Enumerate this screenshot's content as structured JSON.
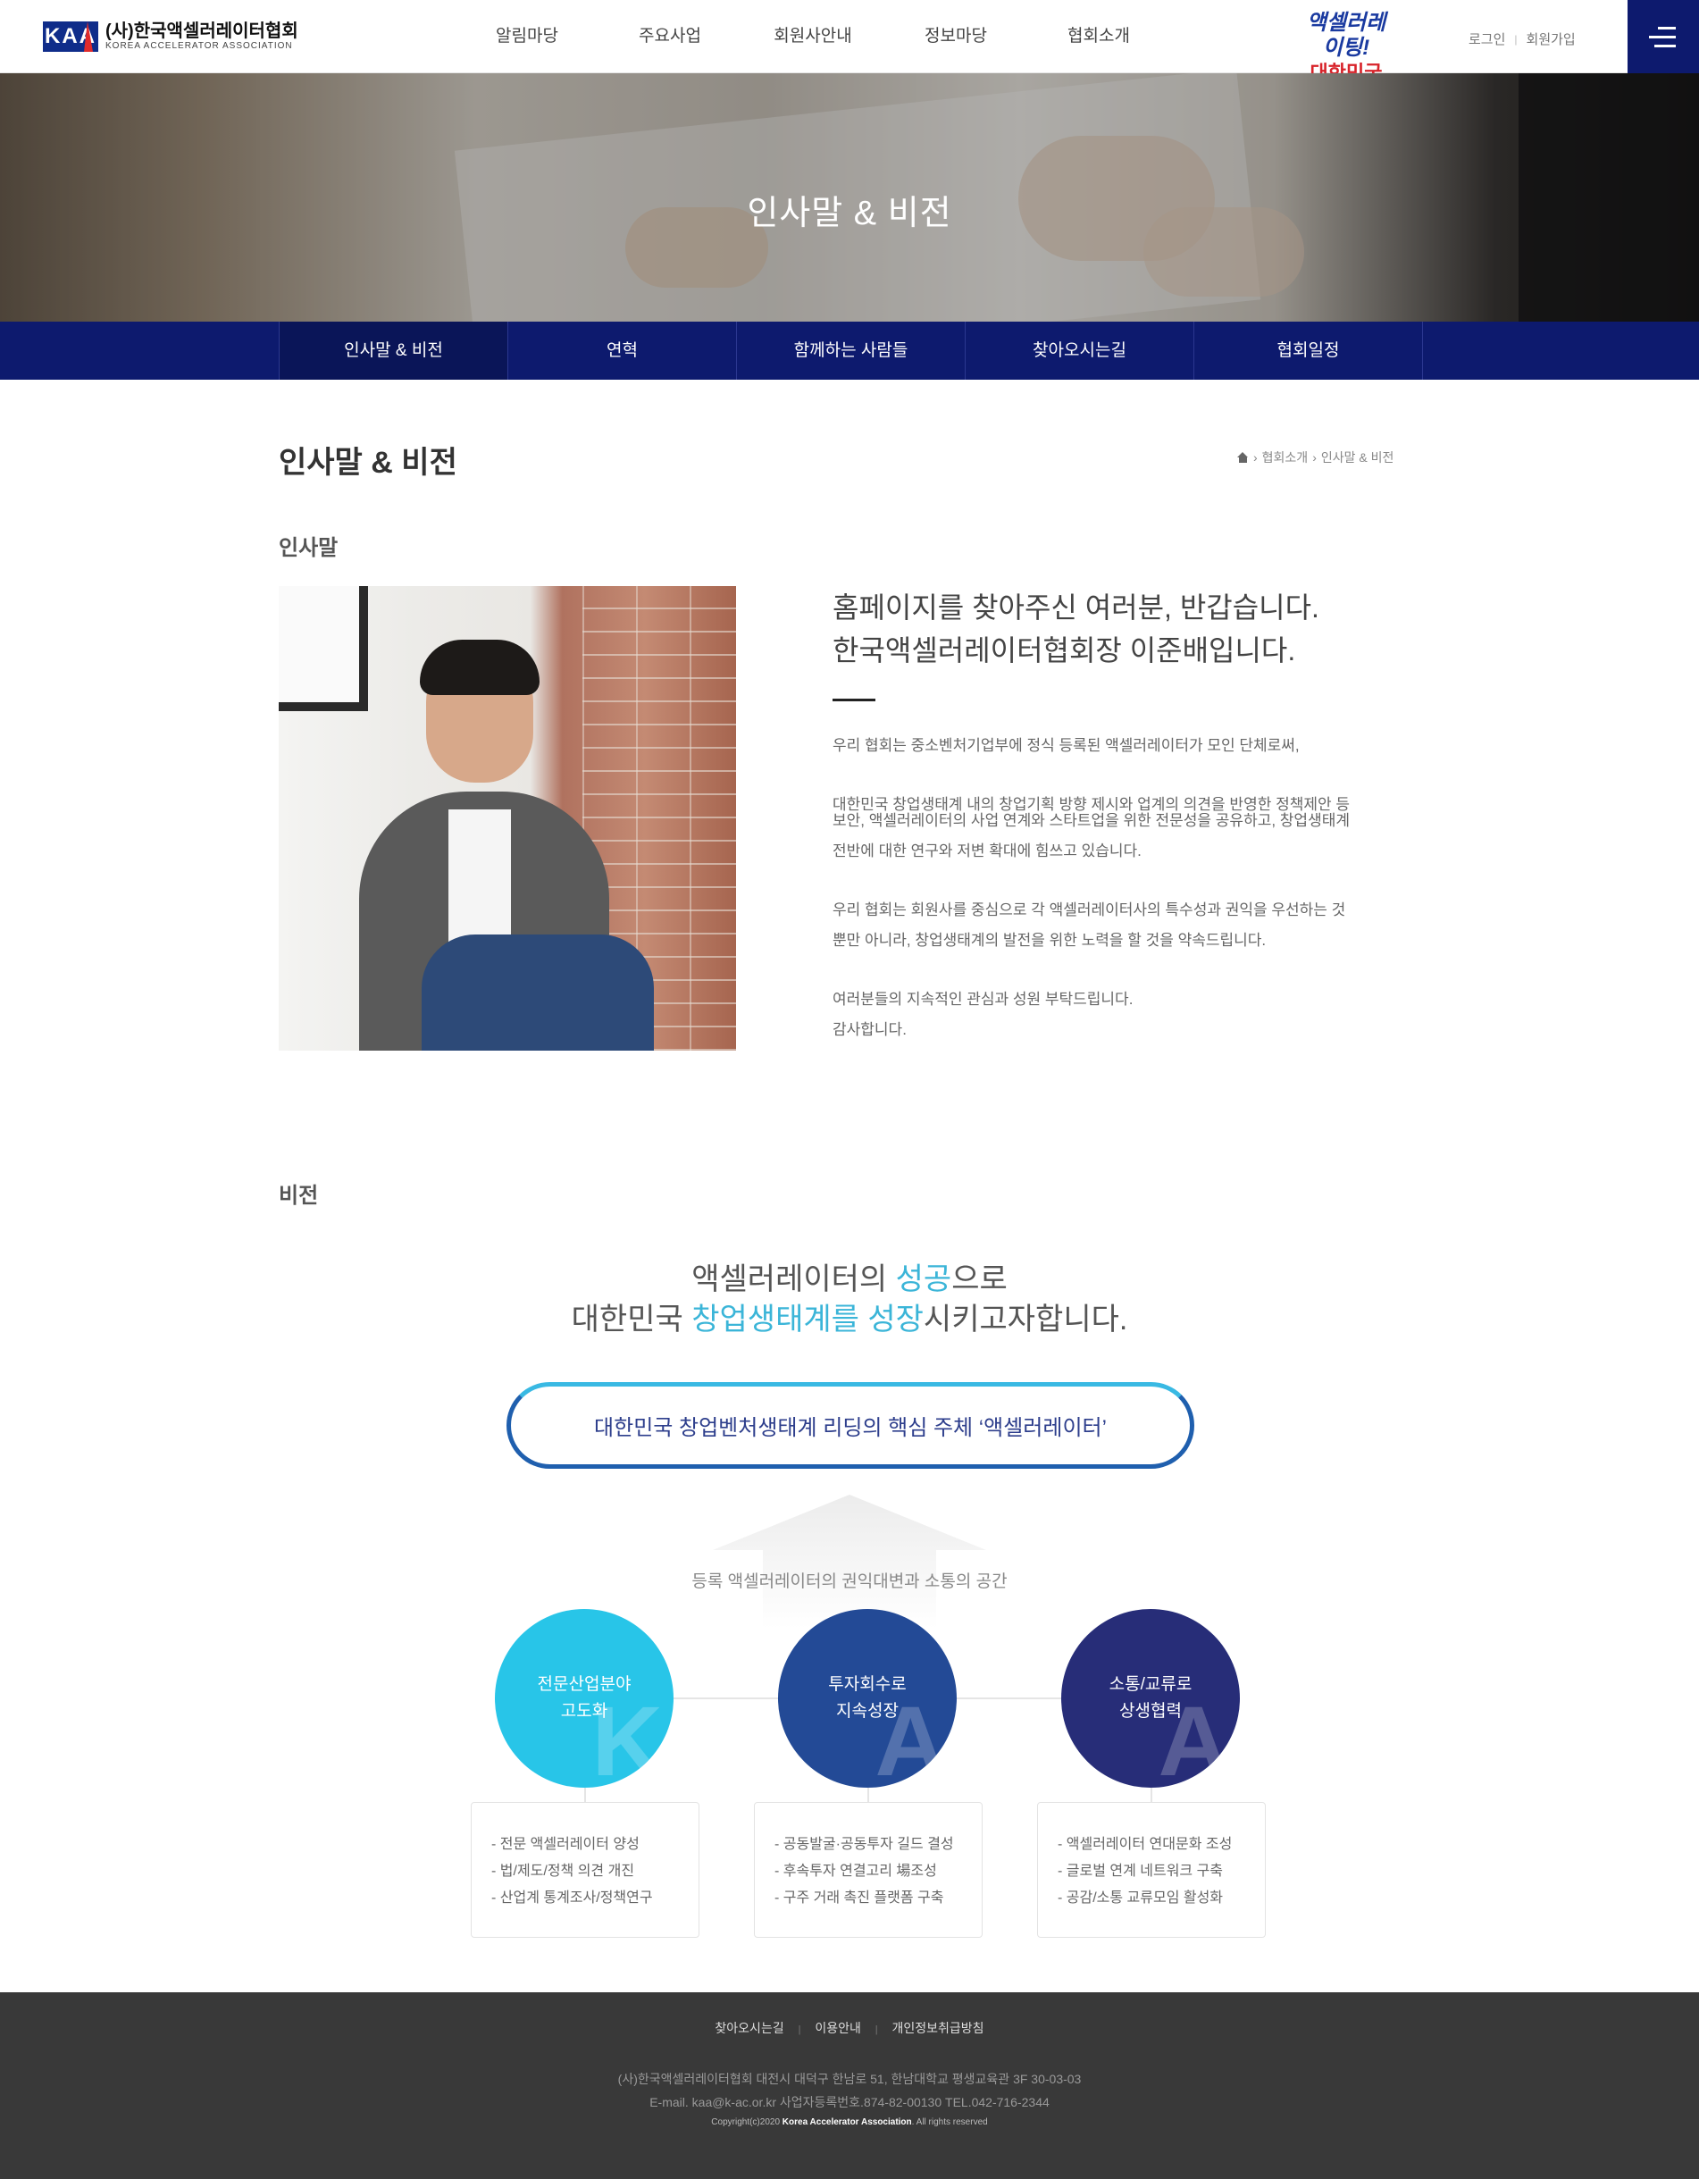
{
  "header": {
    "logo_mark": "KAA",
    "logo_kor": "(사)한국액셀러레이터협회",
    "logo_eng": "KOREA ACCELERATOR ASSOCIATION",
    "nav": [
      "알림마당",
      "주요사업",
      "회원사안내",
      "정보마당",
      "협회소개"
    ],
    "slogan_line1": "액셀러레이팅!",
    "slogan_line2": "대한민국",
    "login": "로그인",
    "join": "회원가입"
  },
  "hero": {
    "title": "인사말 & 비전"
  },
  "subnav": {
    "items": [
      "인사말 & 비전",
      "연혁",
      "함께하는 사람들",
      "찾아오시는길",
      "협회일정"
    ],
    "active_index": 0
  },
  "page": {
    "title": "인사말 & 비전",
    "breadcrumb": {
      "level1": "협회소개",
      "level2": "인사말 & 비전"
    }
  },
  "greeting": {
    "section_title": "인사말",
    "head_line1": "홈페이지를 찾아주신 여러분, 반갑습니다.",
    "head_line2": "한국액셀러레이터협회장 이준배입니다.",
    "p1": "우리 협회는 중소벤처기업부에 정식 등록된 액셀러레이터가 모인 단체로써,",
    "p2a": "대한민국 창업생태계 내의 창업기획 방향 제시와 업계의 의견을 반영한 정책제안 등",
    "p2b": "보안, 액셀러레이터의 사업 연계와 스타트업을 위한 전문성을 공유하고, 창업생태계",
    "p2c": "전반에 대한 연구와 저변 확대에 힘쓰고 있습니다.",
    "p3a": "우리 협회는 회원사를 중심으로 각 액셀러레이터사의 특수성과 권익을 우선하는 것",
    "p3b": "뿐만 아니라, 창업생태계의 발전을 위한 노력을 할 것을 약속드립니다.",
    "p4": "여러분들의 지속적인 관심과 성원 부탁드립니다.",
    "p5": "감사합니다."
  },
  "vision": {
    "section_title": "비전",
    "head_line1_a": "액셀러레이터의 ",
    "head_line1_hl": "성공",
    "head_line1_b": "으로",
    "head_line2_a": "대한민국 ",
    "head_line2_hl": "창업생태계를 성장",
    "head_line2_b": "시키고자합니다.",
    "highlight_color": "#3bb5d8",
    "pill_text": "대한민국 창업벤처생태계 리딩의 핵심 주체 ‘액셀러레이터’",
    "arrow_label": "등록 액셀러레이터의 권익대변과 소통의 공간",
    "pillars": [
      {
        "line1": "전문산업분야",
        "line2": "고도화",
        "letter": "K",
        "color": "#28c5e8",
        "items": [
          "- 전문 액셀러레이터 양성",
          "- 법/제도/정책 의견 개진",
          "- 산업계 통계조사/정책연구"
        ]
      },
      {
        "line1": "투자회수로",
        "line2": "지속성장",
        "letter": "A",
        "color": "#234a96",
        "items": [
          "- 공동발굴·공동투자 길드 결성",
          "- 후속투자 연결고리 場조성",
          "- 구주 거래 촉진 플랫폼 구축"
        ]
      },
      {
        "line1": "소통/교류로",
        "line2": "상생협력",
        "letter": "A",
        "color": "#272d78",
        "items": [
          "- 액셀러레이터 연대문화 조성",
          "- 글로벌 연계 네트워크 구축",
          "- 공감/소통 교류모임 활성화"
        ]
      }
    ]
  },
  "footer": {
    "links": [
      "찾아오시는길",
      "이용안내",
      "개인정보취급방침"
    ],
    "address": "(사)한국액셀러레이터협회 대전시 대덕구 한남로 51, 한남대학교 평생교육관 3F 30-03-03",
    "contact": "E-mail. kaa@k-ac.or.kr 사업자등록번호.874-82-00130 TEL.042-716-2344",
    "copy_prefix": "Copyright(c)2020 ",
    "copy_org": "Korea Accelerator Association",
    "copy_suffix": ". All rights reserved"
  }
}
